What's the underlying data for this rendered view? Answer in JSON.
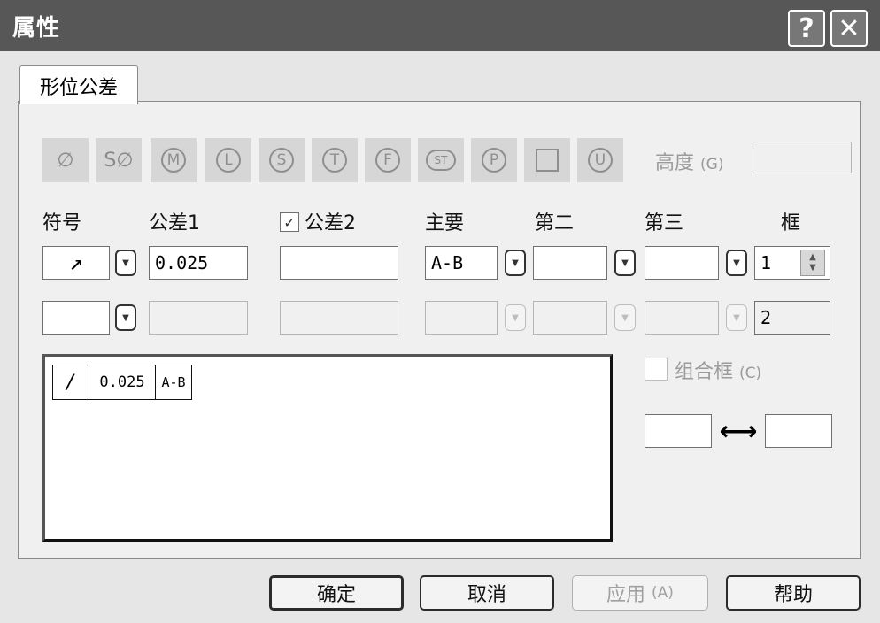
{
  "window": {
    "title": "属性",
    "help_glyph": "?",
    "close_glyph": "✕"
  },
  "tabs": [
    {
      "label": "形位公差"
    }
  ],
  "symbols": {
    "diameter": "∅",
    "spherical_diameter": "S∅",
    "m": "M",
    "l": "L",
    "s": "S",
    "t": "T",
    "f": "F",
    "st": "ST",
    "p": "P",
    "u": "U"
  },
  "height": {
    "label": "高度",
    "accel": "(G)",
    "value": ""
  },
  "columns": {
    "symbol": "符号",
    "tolerance1": "公差1",
    "tolerance2": "公差2",
    "primary": "主要",
    "secondary": "第二",
    "tertiary": "第三",
    "frame": "框"
  },
  "tolerance2_checked": true,
  "rows": [
    {
      "symbol": "↗",
      "tolerance1": "0.025",
      "tolerance2": "",
      "primary": "A-B",
      "secondary": "",
      "tertiary": "",
      "frame": "1"
    },
    {
      "symbol": "",
      "tolerance1": "",
      "tolerance2": "",
      "primary": "",
      "secondary": "",
      "tertiary": "",
      "frame": "2"
    }
  ],
  "preview": {
    "symbol": "/",
    "tolerance": "0.025",
    "datum": "A-B"
  },
  "combine_frame": {
    "label": "组合框",
    "accel": "(C)",
    "checked": false
  },
  "spacing": {
    "left_value": "",
    "right_value": "",
    "arrow_glyph": "⟷"
  },
  "buttons": {
    "ok": "确定",
    "cancel": "取消",
    "apply": "应用",
    "apply_accel": "(A)",
    "help": "帮助"
  }
}
